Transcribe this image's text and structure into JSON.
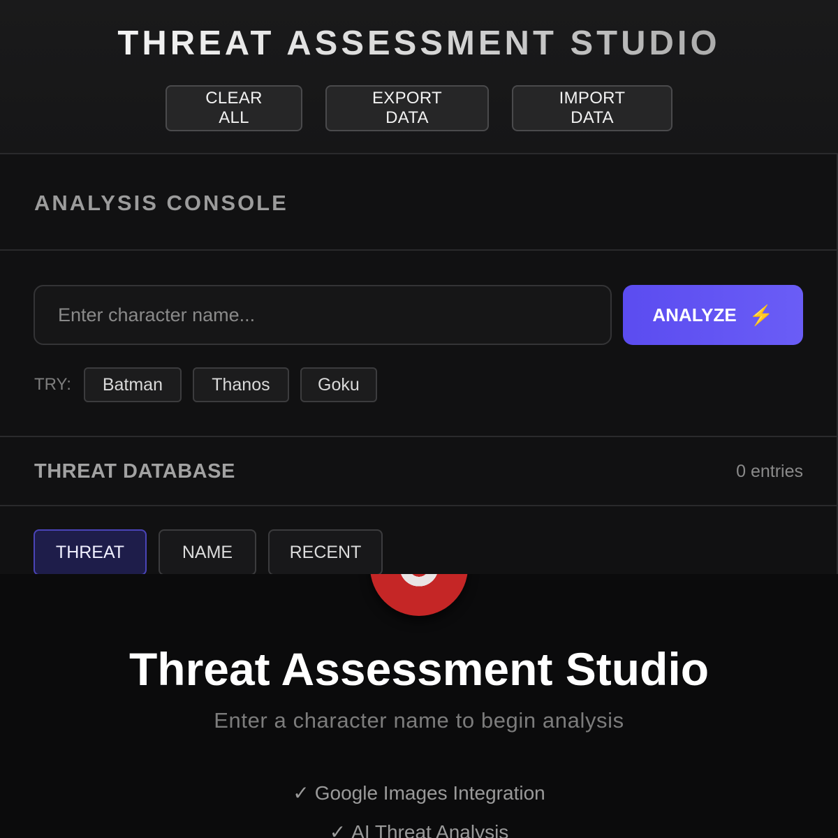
{
  "header": {
    "title": "THREAT ASSESSMENT STUDIO",
    "actions": {
      "clear": "CLEAR ALL",
      "export": "EXPORT DATA",
      "import": "IMPORT DATA"
    }
  },
  "console": {
    "title": "ANALYSIS CONSOLE",
    "search": {
      "placeholder": "Enter character name...",
      "value": ""
    },
    "analyze": {
      "label": "ANALYZE",
      "icon": "⚡"
    },
    "try_label": "TRY:",
    "suggestions": [
      "Batman",
      "Thanos",
      "Goku"
    ]
  },
  "database": {
    "title": "THREAT DATABASE",
    "count": "0 entries",
    "sort": {
      "threat": "THREAT",
      "name": "NAME",
      "recent": "RECENT",
      "active": "threat"
    }
  },
  "empty_state": {
    "icon": "target-icon",
    "title": "Threat Assessment Studio",
    "subtitle": "Enter a character name to begin analysis",
    "check": "✓",
    "features": [
      "Google Images Integration",
      "AI Threat Analysis"
    ]
  },
  "colors": {
    "accent": "#5b4cf0",
    "active_sort_bg": "#1e1d4a",
    "target_red": "#c52626"
  }
}
